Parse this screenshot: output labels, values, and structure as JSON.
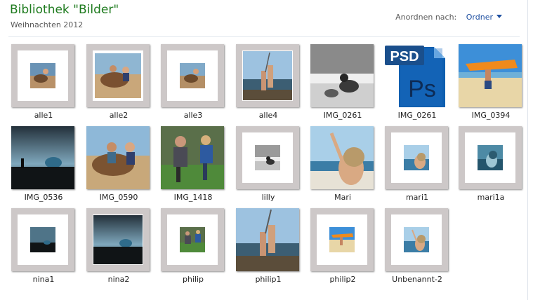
{
  "header": {
    "title": "Bibliothek \"Bilder\"",
    "subtitle": "Weihnachten 2012",
    "arrange_label": "Anordnen nach:",
    "arrange_value": "Ordner"
  },
  "items": [
    {
      "label": "alle1",
      "icon": "photo-thumbnail-icon"
    },
    {
      "label": "alle2",
      "icon": "photo-thumbnail-icon"
    },
    {
      "label": "alle3",
      "icon": "photo-thumbnail-icon"
    },
    {
      "label": "alle4",
      "icon": "photo-thumbnail-icon"
    },
    {
      "label": "IMG_0261",
      "icon": "photo-thumbnail-icon"
    },
    {
      "label": "IMG_0261",
      "icon": "photoshop-psd-icon",
      "psd_text": "PSD",
      "ps_text": "Ps"
    },
    {
      "label": "IMG_0394",
      "icon": "photo-thumbnail-icon"
    },
    {
      "label": "IMG_0536",
      "icon": "photo-thumbnail-icon"
    },
    {
      "label": "IMG_0590",
      "icon": "photo-thumbnail-icon"
    },
    {
      "label": "IMG_1418",
      "icon": "photo-thumbnail-icon"
    },
    {
      "label": "lilly",
      "icon": "photo-thumbnail-icon"
    },
    {
      "label": "Mari",
      "icon": "photo-thumbnail-icon"
    },
    {
      "label": "mari1",
      "icon": "photo-thumbnail-icon"
    },
    {
      "label": "mari1a",
      "icon": "photo-thumbnail-icon"
    },
    {
      "label": "nina1",
      "icon": "photo-thumbnail-icon"
    },
    {
      "label": "nina2",
      "icon": "photo-thumbnail-icon"
    },
    {
      "label": "philip",
      "icon": "photo-thumbnail-icon"
    },
    {
      "label": "philip1",
      "icon": "photo-thumbnail-icon"
    },
    {
      "label": "philip2",
      "icon": "photo-thumbnail-icon"
    },
    {
      "label": "Unbenannt-2",
      "icon": "photo-thumbnail-icon"
    }
  ],
  "colors": {
    "title": "#1e7b1e",
    "link": "#1e4fa1",
    "frame": "#cdc8c8"
  }
}
